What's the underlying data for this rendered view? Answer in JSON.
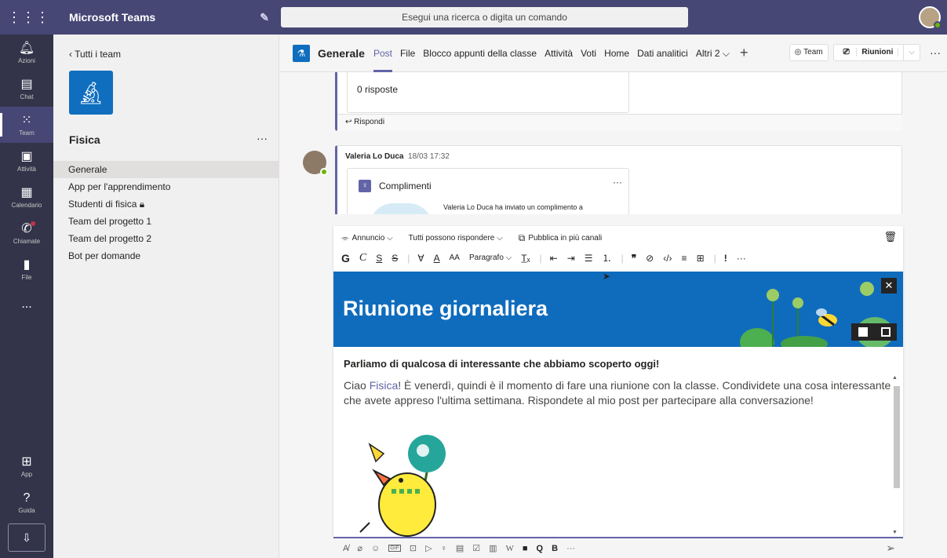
{
  "app": {
    "title": "Microsoft Teams",
    "compose_icon": "compose-icon",
    "waffle_icon": "waffle-icon"
  },
  "search": {
    "placeholder": "Esegui una ricerca o digita un comando"
  },
  "rail": {
    "items": [
      {
        "label": "Azioni",
        "icon": "bell-icon"
      },
      {
        "label": "Chat",
        "icon": "chat-icon"
      },
      {
        "label": "Team",
        "icon": "team-icon"
      },
      {
        "label": "Attività",
        "icon": "assignments-icon"
      },
      {
        "label": "Calendario",
        "icon": "calendar-icon"
      },
      {
        "label": "Chiamate",
        "icon": "phone-icon"
      },
      {
        "label": "File",
        "icon": "file-icon"
      },
      {
        "label": "...",
        "icon": "more-icon"
      }
    ],
    "bottom": [
      {
        "label": "App",
        "icon": "apps-icon"
      },
      {
        "label": "Guida",
        "icon": "help-icon"
      }
    ]
  },
  "teampanel": {
    "back": "Tutti i team",
    "team_name": "Fisica",
    "channels": [
      "Generale",
      "App per l'apprendimento",
      "Studenti di fisica",
      "Team del progetto 1",
      "Team del progetto 2",
      "Bot per domande"
    ]
  },
  "header": {
    "channel": "Generale",
    "tabs": [
      "Post",
      "File",
      "Blocco appunti della classe",
      "Attività",
      "Voti",
      "Home",
      "Dati analitici",
      "Altri 2"
    ],
    "team_btn": "Team",
    "meet_btn": "Riunioni"
  },
  "feed": {
    "replies": "0 risposte",
    "reply": "Rispondi",
    "author": "Valeria Lo Duca",
    "time": "18/03 17:32",
    "card_title": "Complimenti",
    "card_text": "Valeria Lo Duca ha inviato un complimento a"
  },
  "compose": {
    "announcement": "Annuncio",
    "who_can_reply": "Tutti possono rispondere",
    "post_in_multiple": "Pubblica in più canali",
    "paragraph": "Paragrafo",
    "banner_title": "Riunione giornaliera",
    "subject": "Parliamo di qualcosa di interessante che abbiamo scoperto oggi!",
    "body_pre": "Ciao ",
    "body_mention": "Fisica",
    "body_post": "! È venerdì, quindi è il momento di fare una riunione con la classe. Condividete una cosa interessante che avete appreso l'ultima settimana. Rispondete al mio post per partecipare alla conversazione!"
  },
  "colors": {
    "topbar": "#464775",
    "rail": "#33344a",
    "accent": "#6264a7",
    "banner": "#0f6cbd"
  }
}
